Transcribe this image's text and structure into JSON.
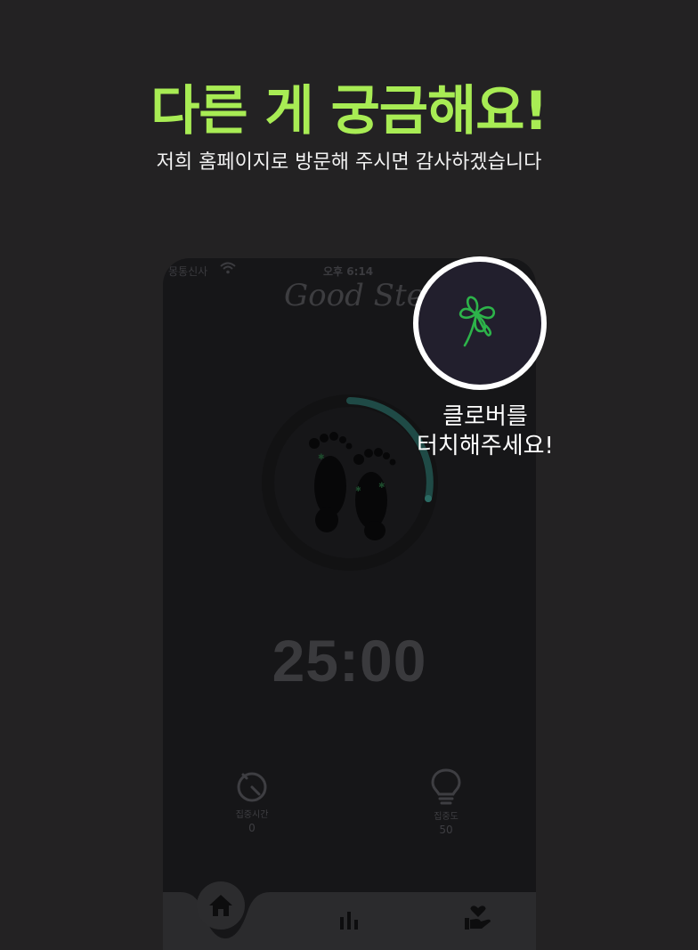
{
  "header": {
    "title": "다른 게 궁금해요!",
    "subtitle": "저희 홈페이지로 방문해 주시면 감사하겠습니다"
  },
  "phone": {
    "status": {
      "carrier": "몽통신사",
      "time": "오후 6:14"
    },
    "logo": "Good Step",
    "timer": "25:00",
    "stats": {
      "focus_time": {
        "label": "집중시간",
        "value": "0"
      },
      "focus_level": {
        "label": "집중도",
        "value": "50"
      }
    },
    "tabs": [
      "home-icon",
      "bar-chart-icon",
      "heart-hand-icon"
    ]
  },
  "callout": {
    "line1": "클로버를",
    "line2": "터치해주세요!"
  },
  "colors": {
    "background": "#232223",
    "accent": "#a8ec54",
    "clover": "#2db34a",
    "phone_bg": "#161618"
  }
}
